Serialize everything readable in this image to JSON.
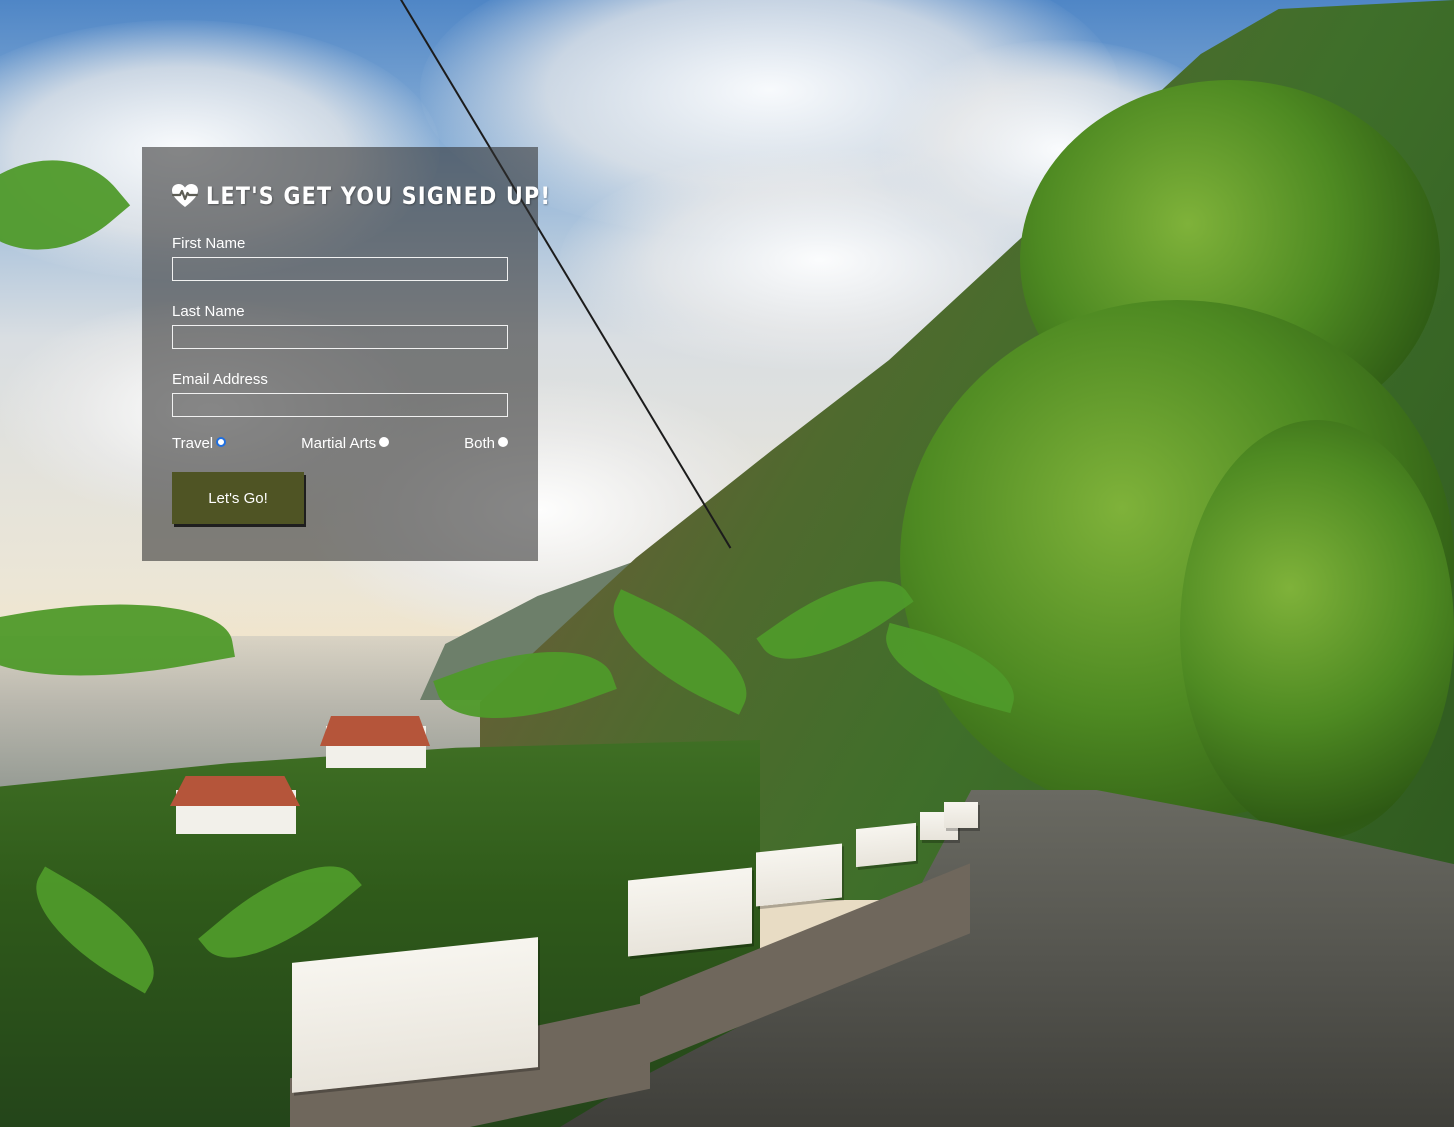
{
  "background": {
    "description_colors": {
      "sky": "#8fb3d8",
      "foliage": "#4e8a22",
      "road": "#55554f"
    }
  },
  "form": {
    "title": "Let's get you signed up!",
    "title_icon": "heartbeat-icon",
    "fields": [
      {
        "label": "First Name",
        "value": "",
        "placeholder": ""
      },
      {
        "label": "Last Name",
        "value": "",
        "placeholder": ""
      },
      {
        "label": "Email Address",
        "value": "",
        "placeholder": ""
      }
    ],
    "radio_options": [
      {
        "label": "Travel",
        "checked": true
      },
      {
        "label": "Martial Arts",
        "checked": false
      },
      {
        "label": "Both",
        "checked": false
      }
    ],
    "submit_label": "Let's Go!",
    "colors": {
      "panel_background": "rgba(48,48,48,0.58)",
      "button_background": "#4f5424",
      "radio_checked_ring": "#1f6fe0"
    }
  }
}
